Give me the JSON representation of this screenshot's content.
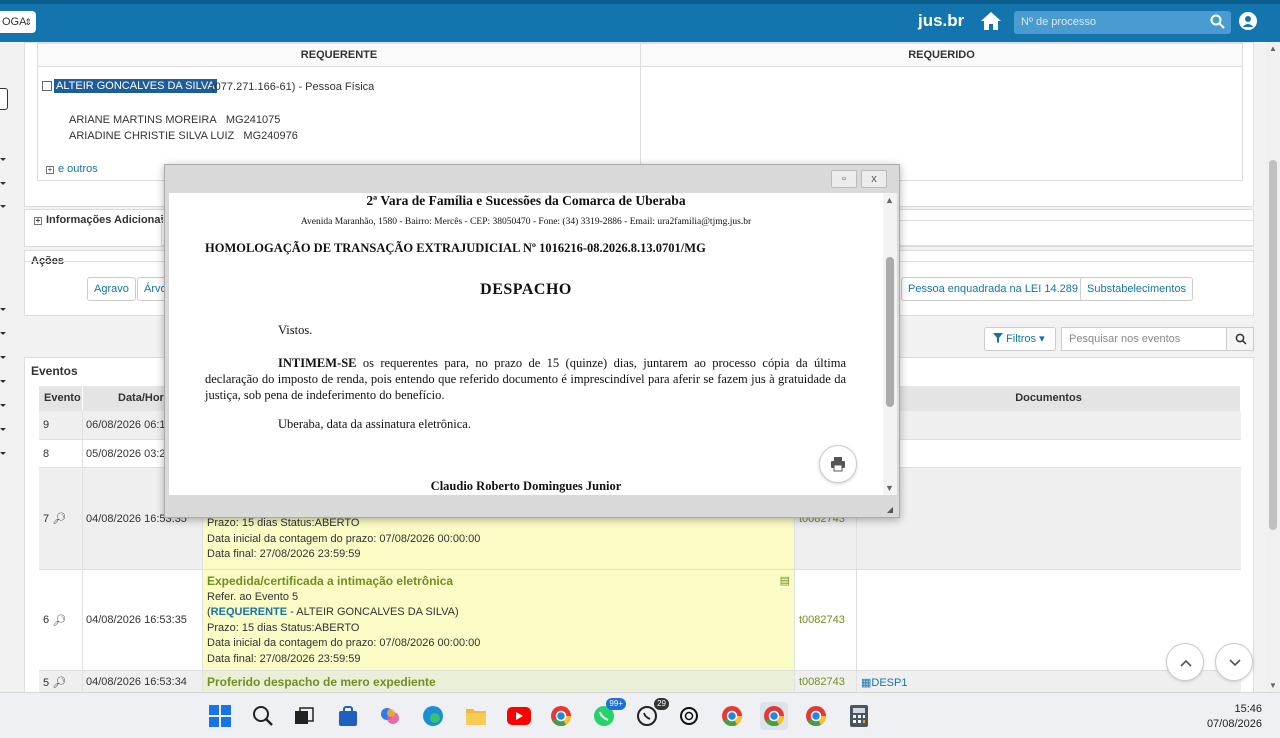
{
  "topbar": {
    "select_label": "OGA",
    "brand": "jus.br",
    "search_placeholder": "Nº de processo"
  },
  "partes": {
    "col_requerente": "REQUERENTE",
    "col_requerido": "REQUERIDO",
    "requerente_nome": "ALTEIR GONCALVES DA SILVA",
    "requerente_doc": "(077.271.166-61)  - Pessoa Física",
    "advogados": [
      {
        "nome": "ARIANE MARTINS MOREIRA",
        "oab": "MG241075"
      },
      {
        "nome": "ARIADINE CHRISTIE SILVA LUIZ",
        "oab": "MG240976"
      }
    ],
    "outros": "e outros"
  },
  "info_adicionais": "Informações Adicionais",
  "acoes": {
    "title": "Ações",
    "buttons": [
      "Agravo",
      "Árvo",
      "Pessoa enquadrada na LEI 14.289",
      "Substabelecimentos"
    ]
  },
  "filtros": {
    "label": "Filtros",
    "search_placeholder": "Pesquisar nos eventos"
  },
  "eventos": {
    "title": "Eventos",
    "headers": {
      "evento": "Evento",
      "data": "Data/Hora",
      "documentos": "Documentos"
    },
    "rows": [
      {
        "num": "9",
        "data": "06/08/2026 06:1"
      },
      {
        "num": "8",
        "data": "05/08/2026 03:2"
      },
      {
        "num": "7",
        "data": "04/08/2026 16:53:35",
        "lines": [
          "Prazo: 15 dias Status:ABERTO",
          "Data inicial da contagem do prazo: 07/08/2026 00:00:00",
          "Data final: 27/08/2026 23:59:59"
        ],
        "usuario": "t0082743"
      },
      {
        "num": "6",
        "data": "04/08/2026 16:53:35",
        "titulo": "Expedida/certificada a intimação eletrônica",
        "ref": "Refer. ao Evento 5",
        "parte_tipo": "REQUERENTE",
        "parte_nome": " - ALTEIR GONCALVES DA SILVA)",
        "lines": [
          "Prazo: 15 dias Status:ABERTO",
          "Data inicial da contagem do prazo: 07/08/2026 00:00:00",
          "Data final: 27/08/2026 23:59:59"
        ],
        "usuario": "t0082743"
      },
      {
        "num": "5",
        "data": "04/08/2026 16:53:34",
        "titulo": "Proferido despacho de mero expediente",
        "usuario": "t0082743",
        "doc": "DESP1"
      }
    ]
  },
  "modal": {
    "orgao": "2ª Vara de Família e Sucessões da Comarca de Uberaba",
    "endereco": "Avenida Maranhão, 1580 - Bairro: Mercês - CEP: 38050470 - Fone: (34) 3319-2886 - Email: ura2familia@tjmg.jus.br",
    "processo": "HOMOLOGAÇÃO DE TRANSAÇÃO EXTRAJUDICIAL Nº 1016216-08.2026.8.13.0701/MG",
    "titulo": "DESPACHO",
    "vistos": "Vistos.",
    "intimem_bold": "INTIMEM-SE",
    "paragrafo": " os requerentes para, no prazo de 15 (quinze) dias, juntarem ao processo cópia da última declaração do imposto de renda, pois entendo que referido documento é imprescindível para aferir se fazem jus à gratuidade da justiça, sob pena de indeferimento do benefício.",
    "local": "Uberaba, data da assinatura eletrônica.",
    "assinatura": "Claudio Roberto Domingues Junior"
  },
  "taskbar": {
    "whatsapp_badge": "99+",
    "chat_badge": "29",
    "time": "15:46",
    "date": "07/08/2026"
  }
}
